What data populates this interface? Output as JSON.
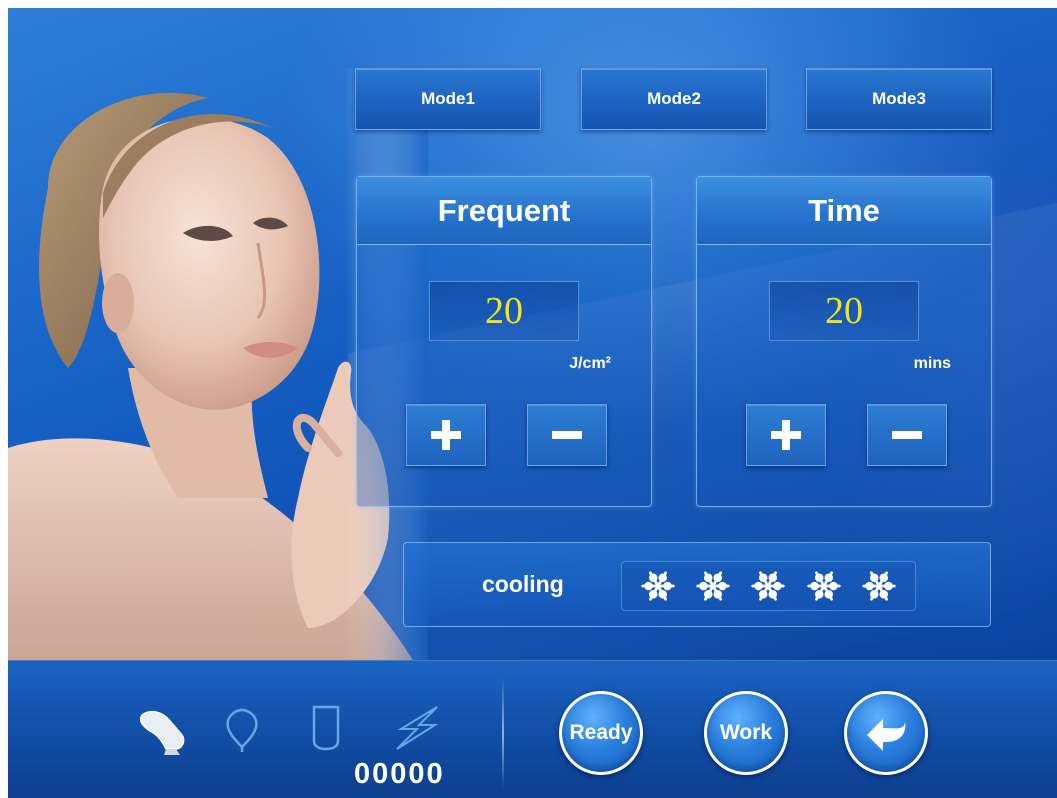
{
  "modes": [
    {
      "label": "Mode1"
    },
    {
      "label": "Mode2"
    },
    {
      "label": "Mode3"
    }
  ],
  "frequent": {
    "title": "Frequent",
    "value": "20",
    "unit": "J/cm²"
  },
  "time": {
    "title": "Time",
    "value": "20",
    "unit": "mins"
  },
  "cooling": {
    "label": "cooling",
    "level": 5,
    "max_level": 5,
    "icon": "snowflake-icon"
  },
  "status": {
    "icons": [
      "handpiece-icon",
      "lamp-icon",
      "cartridge-icon",
      "flash-icon"
    ],
    "counter": "00000"
  },
  "actions": {
    "ready_label": "Ready",
    "work_label": "Work",
    "back_icon": "back-arrow-icon"
  },
  "colors": {
    "value_text": "#f2e41a",
    "background": "#1660c4",
    "label_text": "#ffffff"
  }
}
